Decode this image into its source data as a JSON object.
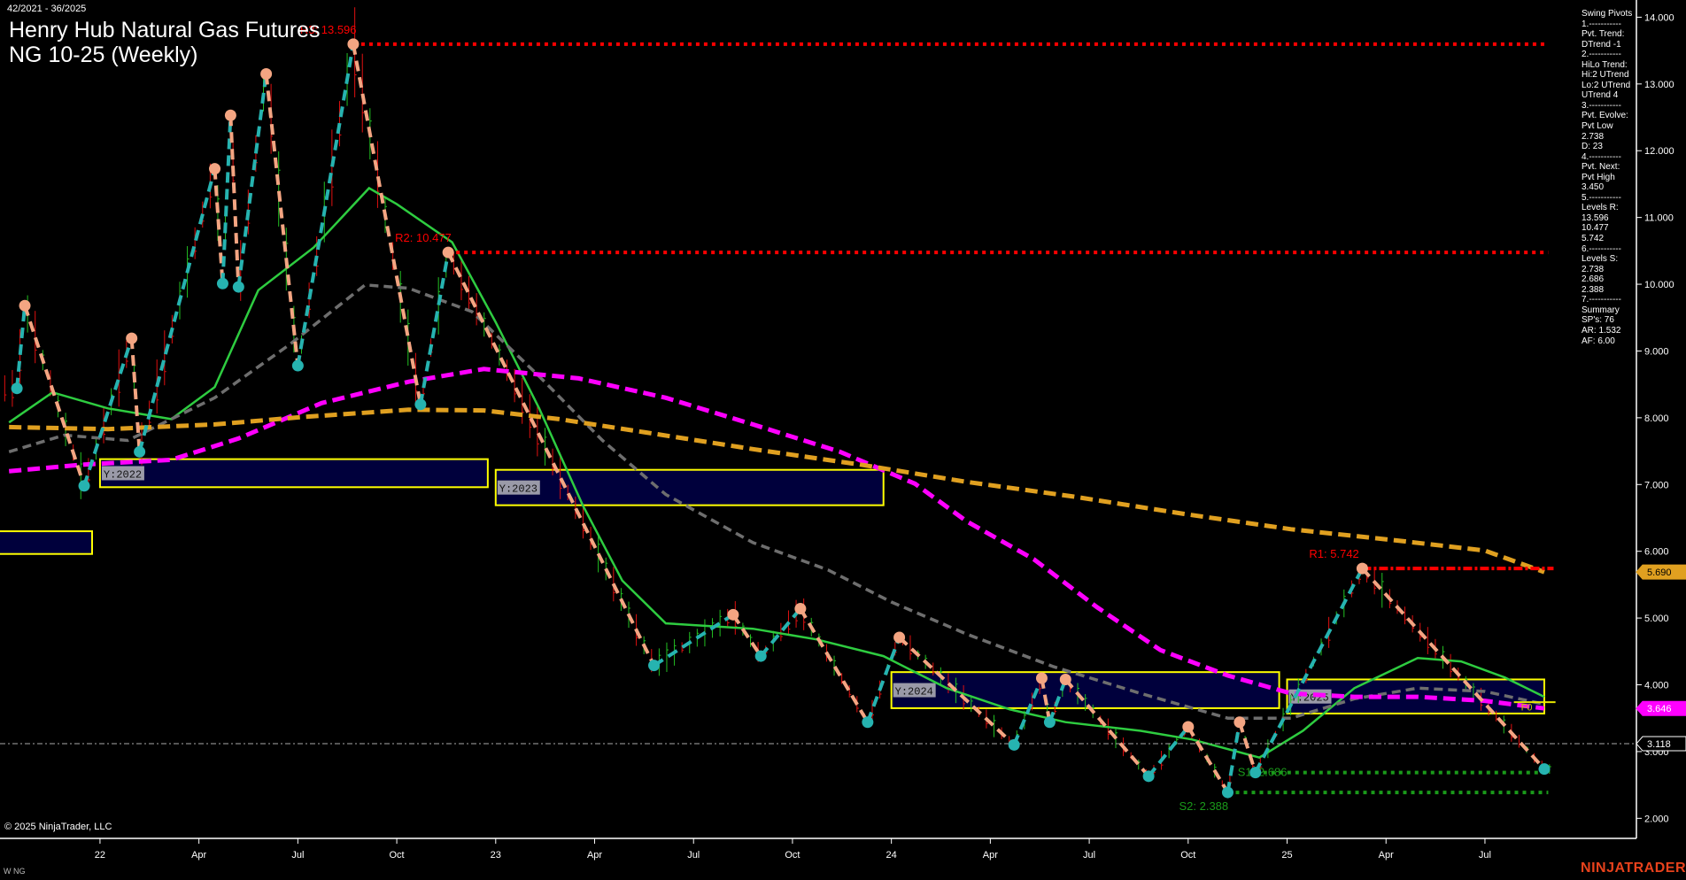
{
  "header": {
    "date_range": "42/2021 - 36/2025",
    "title_line1": "Henry Hub Natural Gas Futures",
    "title_line2": "NG 10-25 (Weekly)"
  },
  "panel": {
    "lines": [
      "Swing Pivots",
      "1.-----------",
      "Pvt. Trend:",
      "DTrend -1",
      "2.-----------",
      "HiLo Trend:",
      "Hi:2 UTrend",
      "Lo:2 UTrend",
      "UTrend 4",
      "3.-----------",
      "Pvt. Evolve:",
      "Pvt Low",
      "2.738",
      "D: 23",
      "4.-----------",
      "Pvt. Next:",
      "Pvt High",
      "3.450",
      "5.-----------",
      "Levels R:",
      "13.596",
      "10.477",
      "5.742",
      "6.-----------",
      "Levels S:",
      "2.738",
      "2.686",
      "2.388",
      "7.-----------",
      "Summary",
      "SP's: 76",
      "AR: 1.532",
      "AF: 6.00"
    ]
  },
  "footer": {
    "copyright": "© 2025 NinjaTrader, LLC",
    "instrument": "W NG",
    "logo": "NINJATRADER"
  },
  "colors": {
    "background": "#000000",
    "up_leg": "#26b3b0",
    "down_leg": "#f4a582",
    "ma_fast": "#2ecc40",
    "ma_mid": "#6e6e6e",
    "ma_slow": "#ff00ff",
    "ma_long": "#e0a020",
    "resistance": "#ff0000",
    "support": "#1a9a1a",
    "year_box": "#ffff00",
    "year_fill": "#00003c"
  },
  "chart_data": {
    "type": "line",
    "title": "Henry Hub Natural Gas Futures NG 10-25 (Weekly)",
    "xlabel": "",
    "ylabel": "",
    "ylim": [
      1.7,
      14.3
    ],
    "xlim": [
      2021.75,
      2025.95
    ],
    "y_ticks": [
      "14.000",
      "13.000",
      "12.000",
      "11.000",
      "10.000",
      "9.000",
      "8.000",
      "7.000",
      "6.000",
      "5.000",
      "4.000",
      "3.000",
      "2.000"
    ],
    "x_ticks": [
      {
        "t": 2022.0,
        "label": "22"
      },
      {
        "t": 2022.25,
        "label": "Apr"
      },
      {
        "t": 2022.5,
        "label": "Jul"
      },
      {
        "t": 2022.75,
        "label": "Oct"
      },
      {
        "t": 2023.0,
        "label": "23"
      },
      {
        "t": 2023.25,
        "label": "Apr"
      },
      {
        "t": 2023.5,
        "label": "Jul"
      },
      {
        "t": 2023.75,
        "label": "Oct"
      },
      {
        "t": 2024.0,
        "label": "24"
      },
      {
        "t": 2024.25,
        "label": "Apr"
      },
      {
        "t": 2024.5,
        "label": "Jul"
      },
      {
        "t": 2024.75,
        "label": "Oct"
      },
      {
        "t": 2025.0,
        "label": "25"
      },
      {
        "t": 2025.25,
        "label": "Apr"
      },
      {
        "t": 2025.5,
        "label": "Jul"
      }
    ],
    "swing_pivots": [
      [
        2021.79,
        8.44,
        "L"
      ],
      [
        2021.81,
        9.68,
        "H"
      ],
      [
        2021.96,
        6.98,
        "L"
      ],
      [
        2022.08,
        9.19,
        "H"
      ],
      [
        2022.1,
        7.49,
        "L"
      ],
      [
        2022.29,
        11.73,
        "H"
      ],
      [
        2022.31,
        10.01,
        "L"
      ],
      [
        2022.33,
        12.53,
        "H"
      ],
      [
        2022.35,
        9.96,
        "L"
      ],
      [
        2022.42,
        13.15,
        "H"
      ],
      [
        2022.5,
        8.78,
        "L"
      ],
      [
        2022.64,
        13.596,
        "H"
      ],
      [
        2022.81,
        8.2,
        "L"
      ],
      [
        2022.88,
        10.477,
        "H"
      ],
      [
        2023.4,
        4.29,
        "L"
      ],
      [
        2023.6,
        5.05,
        "H"
      ],
      [
        2023.67,
        4.43,
        "L"
      ],
      [
        2023.77,
        5.14,
        "H"
      ],
      [
        2023.94,
        3.44,
        "L"
      ],
      [
        2024.02,
        4.71,
        "H"
      ],
      [
        2024.31,
        3.1,
        "L"
      ],
      [
        2024.38,
        4.1,
        "H"
      ],
      [
        2024.4,
        3.44,
        "L"
      ],
      [
        2024.44,
        4.08,
        "H"
      ],
      [
        2024.65,
        2.63,
        "L"
      ],
      [
        2024.75,
        3.37,
        "H"
      ],
      [
        2024.85,
        2.388,
        "L"
      ],
      [
        2024.88,
        3.44,
        "H"
      ],
      [
        2024.92,
        2.686,
        "L"
      ],
      [
        2025.19,
        5.742,
        "H"
      ],
      [
        2025.65,
        2.738,
        "L"
      ]
    ],
    "series": [
      {
        "name": "ma_fast",
        "style": "solid",
        "color": "#2ecc40",
        "points": [
          [
            2021.77,
            7.93
          ],
          [
            2021.88,
            8.38
          ],
          [
            2022.02,
            8.14
          ],
          [
            2022.18,
            7.98
          ],
          [
            2022.29,
            8.46
          ],
          [
            2022.4,
            9.91
          ],
          [
            2022.54,
            10.55
          ],
          [
            2022.68,
            11.44
          ],
          [
            2022.75,
            11.2
          ],
          [
            2022.89,
            10.63
          ],
          [
            2023.0,
            9.43
          ],
          [
            2023.11,
            8.14
          ],
          [
            2023.22,
            6.69
          ],
          [
            2023.32,
            5.56
          ],
          [
            2023.43,
            4.92
          ],
          [
            2023.65,
            4.84
          ],
          [
            2023.81,
            4.68
          ],
          [
            2023.98,
            4.43
          ],
          [
            2024.14,
            3.95
          ],
          [
            2024.3,
            3.63
          ],
          [
            2024.44,
            3.44
          ],
          [
            2024.63,
            3.31
          ],
          [
            2024.76,
            3.18
          ],
          [
            2024.93,
            2.91
          ],
          [
            2025.04,
            3.31
          ],
          [
            2025.17,
            3.95
          ],
          [
            2025.33,
            4.4
          ],
          [
            2025.44,
            4.35
          ],
          [
            2025.55,
            4.11
          ],
          [
            2025.65,
            3.82
          ]
        ]
      },
      {
        "name": "ma_mid",
        "style": "dashed",
        "color": "#6e6e6e",
        "points": [
          [
            2021.77,
            7.49
          ],
          [
            2021.91,
            7.74
          ],
          [
            2022.07,
            7.66
          ],
          [
            2022.29,
            8.3
          ],
          [
            2022.48,
            9.1
          ],
          [
            2022.67,
            9.99
          ],
          [
            2022.78,
            9.94
          ],
          [
            2022.94,
            9.59
          ],
          [
            2023.11,
            8.62
          ],
          [
            2023.27,
            7.66
          ],
          [
            2023.43,
            6.85
          ],
          [
            2023.65,
            6.13
          ],
          [
            2023.84,
            5.72
          ],
          [
            2024.0,
            5.24
          ],
          [
            2024.19,
            4.76
          ],
          [
            2024.41,
            4.27
          ],
          [
            2024.63,
            3.87
          ],
          [
            2024.85,
            3.5
          ],
          [
            2025.01,
            3.5
          ],
          [
            2025.17,
            3.79
          ],
          [
            2025.33,
            3.95
          ],
          [
            2025.5,
            3.9
          ],
          [
            2025.65,
            3.71
          ]
        ]
      },
      {
        "name": "ma_slow",
        "style": "dashed",
        "color": "#ff00ff",
        "points": [
          [
            2021.77,
            7.2
          ],
          [
            2021.96,
            7.3
          ],
          [
            2022.18,
            7.37
          ],
          [
            2022.35,
            7.69
          ],
          [
            2022.56,
            8.22
          ],
          [
            2022.78,
            8.54
          ],
          [
            2022.97,
            8.73
          ],
          [
            2023.21,
            8.59
          ],
          [
            2023.43,
            8.3
          ],
          [
            2023.65,
            7.9
          ],
          [
            2023.87,
            7.49
          ],
          [
            2024.06,
            7.01
          ],
          [
            2024.19,
            6.45
          ],
          [
            2024.36,
            5.88
          ],
          [
            2024.52,
            5.16
          ],
          [
            2024.68,
            4.52
          ],
          [
            2024.85,
            4.14
          ],
          [
            2025.01,
            3.87
          ],
          [
            2025.17,
            3.82
          ],
          [
            2025.33,
            3.82
          ],
          [
            2025.5,
            3.76
          ],
          [
            2025.65,
            3.646
          ]
        ]
      },
      {
        "name": "ma_long",
        "style": "dashed",
        "color": "#e0a020",
        "points": [
          [
            2021.77,
            7.86
          ],
          [
            2022.02,
            7.83
          ],
          [
            2022.29,
            7.9
          ],
          [
            2022.51,
            8.01
          ],
          [
            2022.78,
            8.12
          ],
          [
            2022.97,
            8.11
          ],
          [
            2023.16,
            7.98
          ],
          [
            2023.38,
            7.78
          ],
          [
            2023.65,
            7.53
          ],
          [
            2023.92,
            7.3
          ],
          [
            2024.19,
            7.04
          ],
          [
            2024.46,
            6.82
          ],
          [
            2024.74,
            6.56
          ],
          [
            2025.01,
            6.33
          ],
          [
            2025.28,
            6.16
          ],
          [
            2025.5,
            6.01
          ],
          [
            2025.65,
            5.69
          ]
        ]
      }
    ],
    "year_boxes": [
      {
        "label": "",
        "t0": 2021.5,
        "t1": 2021.98,
        "hi": 6.3,
        "lo": 5.96
      },
      {
        "label": "Y:2022",
        "t0": 2022.0,
        "t1": 2022.98,
        "hi": 7.38,
        "lo": 6.96
      },
      {
        "label": "Y:2023",
        "t0": 2023.0,
        "t1": 2023.98,
        "hi": 7.22,
        "lo": 6.69
      },
      {
        "label": "Y:2024",
        "t0": 2024.0,
        "t1": 2024.98,
        "hi": 4.19,
        "lo": 3.65
      },
      {
        "label": "Y:2025",
        "t0": 2025.0,
        "t1": 2025.65,
        "hi": 4.08,
        "lo": 3.57
      }
    ],
    "levels": [
      {
        "label": "R3: 13.596",
        "value": 13.596,
        "t0": 2022.64,
        "kind": "R"
      },
      {
        "label": "R2: 10.477",
        "value": 10.477,
        "t0": 2022.88,
        "kind": "R"
      },
      {
        "label": "R1: 5.742",
        "value": 5.742,
        "t0": 2025.19,
        "kind": "R1"
      },
      {
        "label": "S1: 2.686",
        "value": 2.686,
        "t0": 2024.92,
        "kind": "S"
      },
      {
        "label": "S2: 2.388",
        "value": 2.388,
        "t0": 2024.85,
        "kind": "S"
      }
    ],
    "fib_label": {
      "label": "F0",
      "value": 3.72,
      "t": 2025.6
    },
    "last_price": 3.118,
    "price_tags": [
      {
        "value": "5.690",
        "bg": "#e0a020",
        "fg": "#000000",
        "border": "#e0a020"
      },
      {
        "value": "3.646",
        "bg": "#ff00ff",
        "fg": "#ffffff",
        "border": "#ff00ff"
      },
      {
        "value": "3.118",
        "bg": "#000000",
        "fg": "#ffffff",
        "border": "#ffffff"
      }
    ]
  }
}
